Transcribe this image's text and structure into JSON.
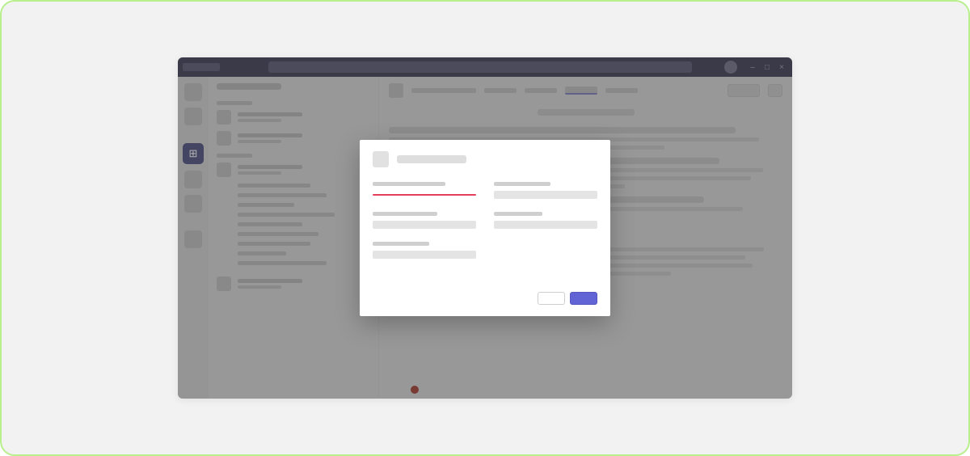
{
  "frame": {
    "border_color": "#b8f08d",
    "bg_color": "#f2f2f2"
  },
  "app": {
    "name_placeholder": "",
    "accent_color": "#6264d5",
    "error_color": "#e43f5a",
    "titlebar": {
      "brand": "",
      "search_placeholder": "",
      "window_controls": {
        "minimize": "–",
        "maximize": "□",
        "close": "×"
      }
    },
    "rail": {
      "items": [
        {
          "id": "activity",
          "active": false
        },
        {
          "id": "chat",
          "active": false
        },
        {
          "id": "teams",
          "active": true,
          "glyph": "⊞"
        },
        {
          "id": "calendar",
          "active": false
        },
        {
          "id": "calls",
          "active": false
        },
        {
          "id": "files",
          "active": false
        }
      ]
    },
    "sidebar": {
      "header": "",
      "sections": [
        {
          "label": "",
          "teams": [
            {
              "name": "",
              "sub": "",
              "channels": []
            },
            {
              "name": "",
              "sub": "",
              "channels": []
            }
          ]
        },
        {
          "label": "",
          "teams": [
            {
              "name": "",
              "sub": "",
              "channels": [
                "",
                "",
                "",
                "",
                "",
                "",
                "",
                "",
                ""
              ]
            },
            {
              "name": "",
              "sub": "",
              "channels": []
            }
          ]
        }
      ]
    },
    "main": {
      "header": {
        "icon": "",
        "title": "",
        "tabs": [
          {
            "label": "",
            "active": false
          },
          {
            "label": "",
            "active": false
          },
          {
            "label": "",
            "active": true
          },
          {
            "label": "",
            "active": false
          }
        ],
        "action_button": "",
        "chevron": ""
      },
      "feed": {
        "date_divider": "",
        "posts": [
          {
            "author": "",
            "lines": [
              "",
              "",
              ""
            ]
          },
          {
            "author": "",
            "lines": [
              "",
              "",
              "",
              "",
              ""
            ]
          }
        ]
      }
    }
  },
  "modal": {
    "icon": "",
    "title": "",
    "fields": [
      {
        "label": "",
        "value": "",
        "error": true
      },
      {
        "label": "",
        "value": "",
        "error": false
      },
      {
        "label": "",
        "value": "",
        "error": false
      },
      {
        "label": "",
        "value": "",
        "error": false
      },
      {
        "label": "",
        "value": "",
        "error": false
      }
    ],
    "buttons": {
      "secondary": "",
      "primary": ""
    }
  }
}
